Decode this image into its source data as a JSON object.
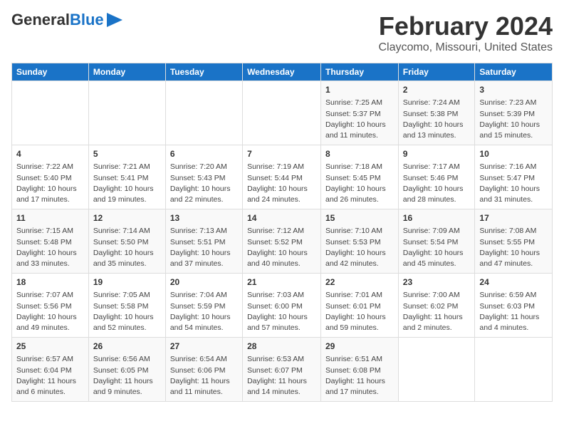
{
  "header": {
    "logo_line1": "General",
    "logo_line2": "Blue",
    "month": "February 2024",
    "location": "Claycomo, Missouri, United States"
  },
  "days_of_week": [
    "Sunday",
    "Monday",
    "Tuesday",
    "Wednesday",
    "Thursday",
    "Friday",
    "Saturday"
  ],
  "weeks": [
    [
      {
        "day": "",
        "info": ""
      },
      {
        "day": "",
        "info": ""
      },
      {
        "day": "",
        "info": ""
      },
      {
        "day": "",
        "info": ""
      },
      {
        "day": "1",
        "info": "Sunrise: 7:25 AM\nSunset: 5:37 PM\nDaylight: 10 hours\nand 11 minutes."
      },
      {
        "day": "2",
        "info": "Sunrise: 7:24 AM\nSunset: 5:38 PM\nDaylight: 10 hours\nand 13 minutes."
      },
      {
        "day": "3",
        "info": "Sunrise: 7:23 AM\nSunset: 5:39 PM\nDaylight: 10 hours\nand 15 minutes."
      }
    ],
    [
      {
        "day": "4",
        "info": "Sunrise: 7:22 AM\nSunset: 5:40 PM\nDaylight: 10 hours\nand 17 minutes."
      },
      {
        "day": "5",
        "info": "Sunrise: 7:21 AM\nSunset: 5:41 PM\nDaylight: 10 hours\nand 19 minutes."
      },
      {
        "day": "6",
        "info": "Sunrise: 7:20 AM\nSunset: 5:43 PM\nDaylight: 10 hours\nand 22 minutes."
      },
      {
        "day": "7",
        "info": "Sunrise: 7:19 AM\nSunset: 5:44 PM\nDaylight: 10 hours\nand 24 minutes."
      },
      {
        "day": "8",
        "info": "Sunrise: 7:18 AM\nSunset: 5:45 PM\nDaylight: 10 hours\nand 26 minutes."
      },
      {
        "day": "9",
        "info": "Sunrise: 7:17 AM\nSunset: 5:46 PM\nDaylight: 10 hours\nand 28 minutes."
      },
      {
        "day": "10",
        "info": "Sunrise: 7:16 AM\nSunset: 5:47 PM\nDaylight: 10 hours\nand 31 minutes."
      }
    ],
    [
      {
        "day": "11",
        "info": "Sunrise: 7:15 AM\nSunset: 5:48 PM\nDaylight: 10 hours\nand 33 minutes."
      },
      {
        "day": "12",
        "info": "Sunrise: 7:14 AM\nSunset: 5:50 PM\nDaylight: 10 hours\nand 35 minutes."
      },
      {
        "day": "13",
        "info": "Sunrise: 7:13 AM\nSunset: 5:51 PM\nDaylight: 10 hours\nand 37 minutes."
      },
      {
        "day": "14",
        "info": "Sunrise: 7:12 AM\nSunset: 5:52 PM\nDaylight: 10 hours\nand 40 minutes."
      },
      {
        "day": "15",
        "info": "Sunrise: 7:10 AM\nSunset: 5:53 PM\nDaylight: 10 hours\nand 42 minutes."
      },
      {
        "day": "16",
        "info": "Sunrise: 7:09 AM\nSunset: 5:54 PM\nDaylight: 10 hours\nand 45 minutes."
      },
      {
        "day": "17",
        "info": "Sunrise: 7:08 AM\nSunset: 5:55 PM\nDaylight: 10 hours\nand 47 minutes."
      }
    ],
    [
      {
        "day": "18",
        "info": "Sunrise: 7:07 AM\nSunset: 5:56 PM\nDaylight: 10 hours\nand 49 minutes."
      },
      {
        "day": "19",
        "info": "Sunrise: 7:05 AM\nSunset: 5:58 PM\nDaylight: 10 hours\nand 52 minutes."
      },
      {
        "day": "20",
        "info": "Sunrise: 7:04 AM\nSunset: 5:59 PM\nDaylight: 10 hours\nand 54 minutes."
      },
      {
        "day": "21",
        "info": "Sunrise: 7:03 AM\nSunset: 6:00 PM\nDaylight: 10 hours\nand 57 minutes."
      },
      {
        "day": "22",
        "info": "Sunrise: 7:01 AM\nSunset: 6:01 PM\nDaylight: 10 hours\nand 59 minutes."
      },
      {
        "day": "23",
        "info": "Sunrise: 7:00 AM\nSunset: 6:02 PM\nDaylight: 11 hours\nand 2 minutes."
      },
      {
        "day": "24",
        "info": "Sunrise: 6:59 AM\nSunset: 6:03 PM\nDaylight: 11 hours\nand 4 minutes."
      }
    ],
    [
      {
        "day": "25",
        "info": "Sunrise: 6:57 AM\nSunset: 6:04 PM\nDaylight: 11 hours\nand 6 minutes."
      },
      {
        "day": "26",
        "info": "Sunrise: 6:56 AM\nSunset: 6:05 PM\nDaylight: 11 hours\nand 9 minutes."
      },
      {
        "day": "27",
        "info": "Sunrise: 6:54 AM\nSunset: 6:06 PM\nDaylight: 11 hours\nand 11 minutes."
      },
      {
        "day": "28",
        "info": "Sunrise: 6:53 AM\nSunset: 6:07 PM\nDaylight: 11 hours\nand 14 minutes."
      },
      {
        "day": "29",
        "info": "Sunrise: 6:51 AM\nSunset: 6:08 PM\nDaylight: 11 hours\nand 17 minutes."
      },
      {
        "day": "",
        "info": ""
      },
      {
        "day": "",
        "info": ""
      }
    ]
  ]
}
